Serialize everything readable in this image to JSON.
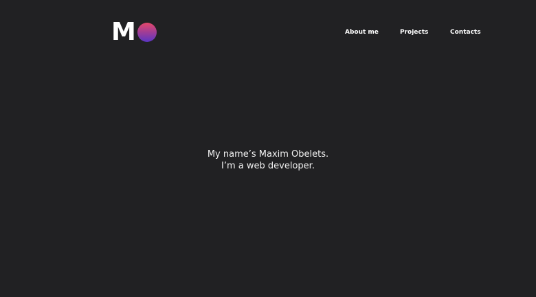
{
  "logo": {
    "letter": "M"
  },
  "nav": {
    "items": [
      {
        "label": "About me"
      },
      {
        "label": "Projects"
      },
      {
        "label": "Contacts"
      }
    ]
  },
  "hero": {
    "line1": "My name’s Maxim Obelets.",
    "line2": "I’m a web developer."
  },
  "colors": {
    "background": "#212123",
    "text": "#ffffff",
    "logo_gradient_top": "#e4486a",
    "logo_gradient_bottom": "#5b35c4"
  }
}
